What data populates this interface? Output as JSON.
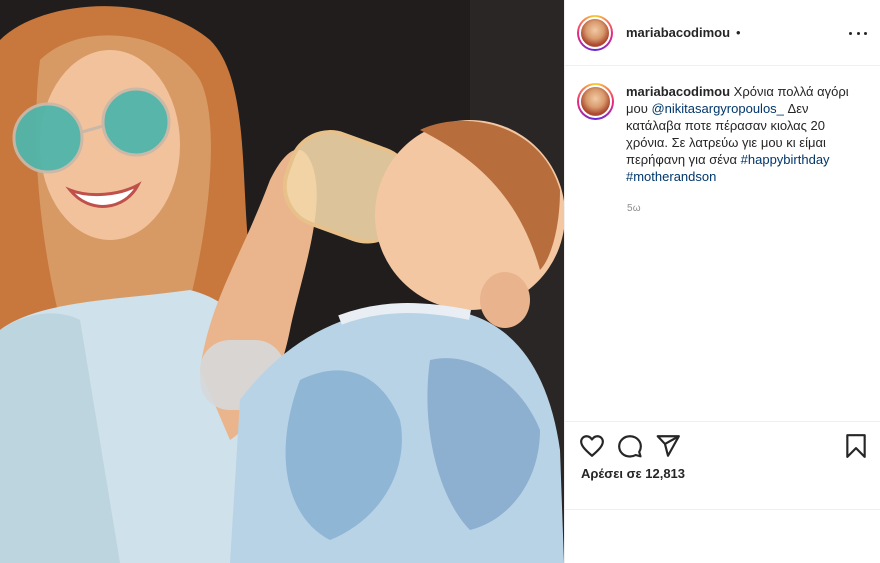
{
  "post": {
    "image_alt": "",
    "author": "mariabacodimou",
    "dot": "•",
    "caption": {
      "username": "mariabacodimou",
      "text_1": "Χρόνια πολλά αγόρι μου",
      "mention": "@nikitasargyropoulos_",
      "text_2": "Δεν κατάλαβα ποτε πέρασαν κιολας 20 χρόνια. Σε λατρεύω γιε μου κι είμαι περήφανη για σένα",
      "hashtag_1": "#happybirthday",
      "hashtag_2": "#motherandson"
    },
    "time": "5ω",
    "likes": "Αρέσει σε 12,813"
  },
  "icons": {
    "more": "more-horizontal-icon",
    "like": "heart-icon",
    "comment": "comment-icon",
    "share": "paper-plane-icon",
    "save": "bookmark-icon"
  },
  "colors": {
    "text": "#262626",
    "link": "#00376b",
    "muted": "#8e8e8e",
    "divider": "#efefef"
  }
}
